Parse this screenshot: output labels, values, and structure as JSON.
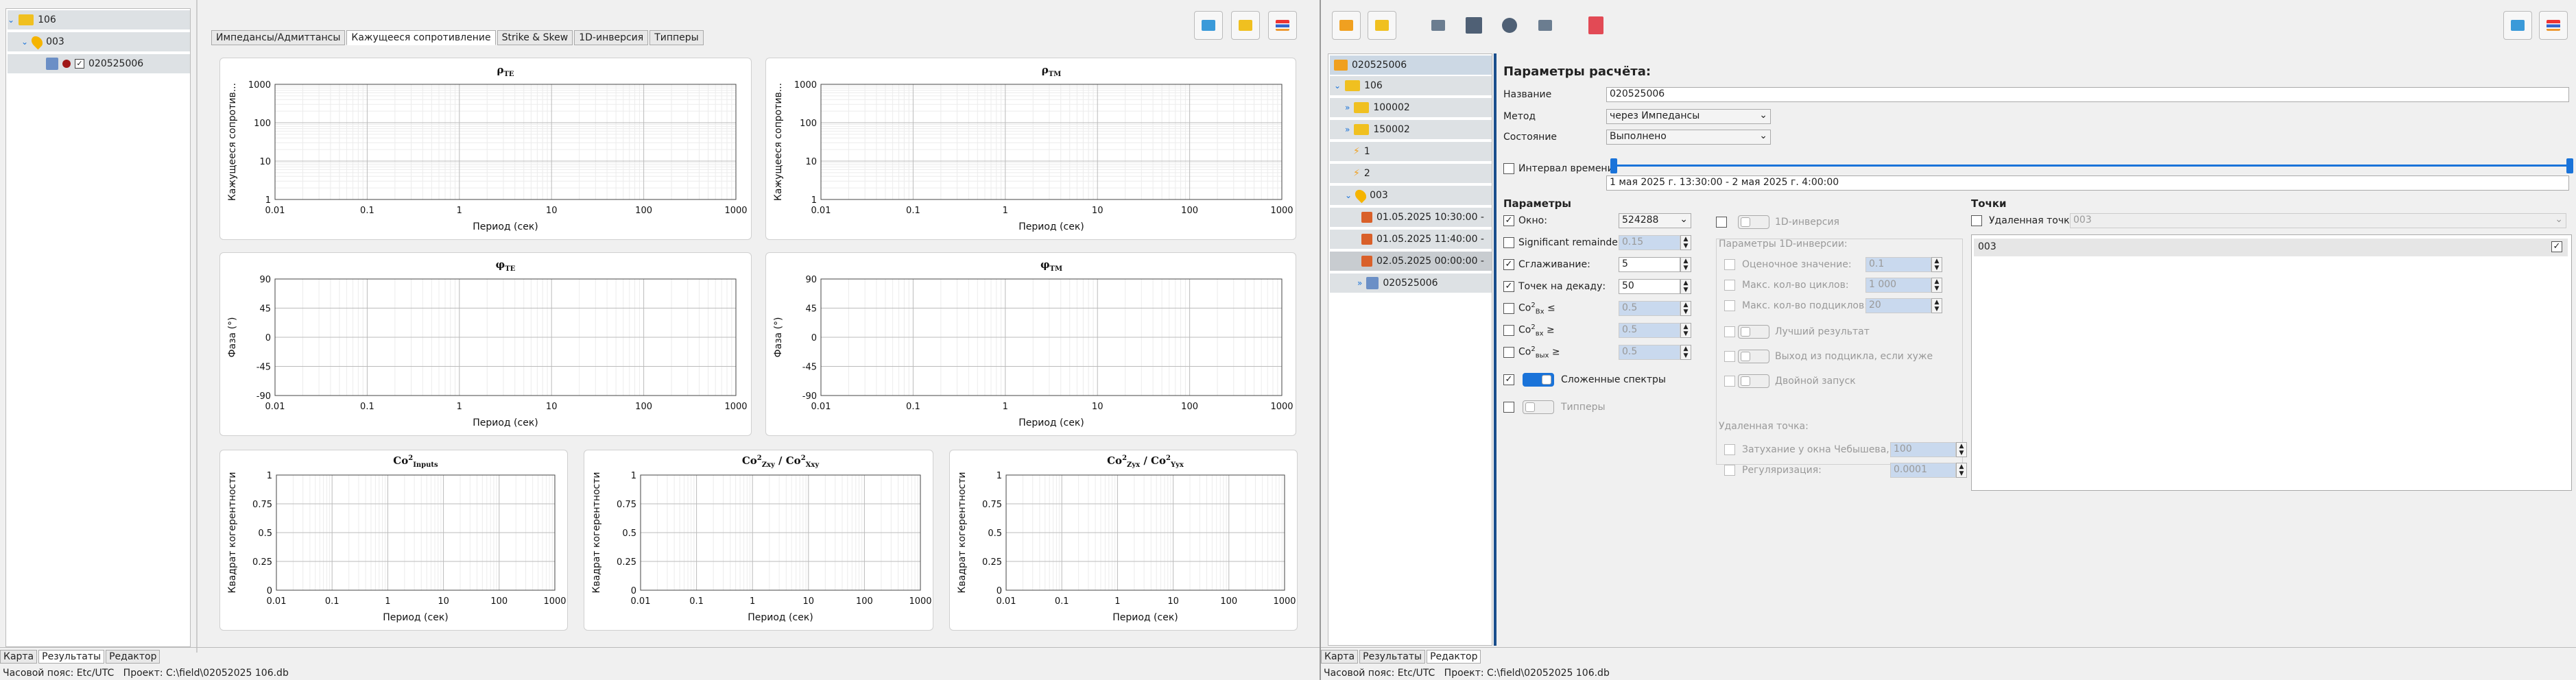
{
  "left_tree": {
    "items": [
      {
        "label": "106"
      },
      {
        "label": "003"
      },
      {
        "label": "020525006"
      }
    ]
  },
  "plot_tabs": [
    "Импедансы/Адмиттансы",
    "Кажущееся сопротивление",
    "Strike & Skew",
    "1D-инверсия",
    "Типперы"
  ],
  "active_tab": 1,
  "bottom_tabs": [
    "Карта",
    "Результаты",
    "Редактор"
  ],
  "status": {
    "tz": "Часовой пояс: Etc/UTC",
    "project": "Проект: C:\\field\\02052025 106.db"
  },
  "charts": {
    "rho_te": {
      "title": "ρ",
      "sub": "TE",
      "ylabel": "Кажущееся сопротив...",
      "xlabel": "Период (сек)",
      "xticks": [
        "0.01",
        "0.1",
        "1",
        "10",
        "100",
        "1000"
      ],
      "yticks": [
        "1000",
        "100",
        "10",
        "1"
      ]
    },
    "rho_tm": {
      "title": "ρ",
      "sub": "TM",
      "ylabel": "Кажущееся сопротив...",
      "xlabel": "Период (сек)",
      "xticks": [
        "0.01",
        "0.1",
        "1",
        "10",
        "100",
        "1000"
      ],
      "yticks": [
        "1000",
        "100",
        "10",
        "1"
      ]
    },
    "phi_te": {
      "title": "φ",
      "sub": "TE",
      "ylabel": "Фаза (°)",
      "xlabel": "Период (сек)",
      "xticks": [
        "0.01",
        "0.1",
        "1",
        "10",
        "100",
        "1000"
      ],
      "yticks": [
        "90",
        "45",
        "0",
        "-45",
        "-90"
      ]
    },
    "phi_tm": {
      "title": "φ",
      "sub": "TM",
      "ylabel": "Фаза (°)",
      "xlabel": "Период (сек)",
      "xticks": [
        "0.01",
        "0.1",
        "1",
        "10",
        "100",
        "1000"
      ],
      "yticks": [
        "90",
        "45",
        "0",
        "-45",
        "-90"
      ]
    },
    "coh_in": {
      "title": "Co",
      "sup": "2",
      "sub": "Inputs",
      "ylabel": "Квадрат когерентности",
      "xlabel": "Период (сек)",
      "xticks": [
        "0.01",
        "0.1",
        "1",
        "10",
        "100",
        "1000"
      ],
      "yticks": [
        "1",
        "0.75",
        "0.5",
        "0.25",
        "0"
      ]
    },
    "coh_zxy": {
      "title": "Co",
      "sup": "2",
      "sub": "Zxy",
      "title2": " / Co",
      "sup2": "2",
      "sub2": "Xxy",
      "ylabel": "Квадрат когерентности",
      "xlabel": "Период (сек)",
      "xticks": [
        "0.01",
        "0.1",
        "1",
        "10",
        "100",
        "1000"
      ],
      "yticks": [
        "1",
        "0.75",
        "0.5",
        "0.25",
        "0"
      ]
    },
    "coh_zyx": {
      "title": "Co",
      "sup": "2",
      "sub": "Zyx",
      "title2": " / Co",
      "sup2": "2",
      "sub2": "Yyx",
      "ylabel": "Квадрат когерентности",
      "xlabel": "Период (сек)",
      "xticks": [
        "0.01",
        "0.1",
        "1",
        "10",
        "100",
        "1000"
      ],
      "yticks": [
        "1",
        "0.75",
        "0.5",
        "0.25",
        "0"
      ]
    }
  },
  "right_tree": {
    "items": [
      {
        "label": "020525006"
      },
      {
        "label": "106"
      },
      {
        "label": "100002"
      },
      {
        "label": "150002"
      },
      {
        "label": "1"
      },
      {
        "label": "2"
      },
      {
        "label": "003"
      },
      {
        "label": "01.05.2025 10:30:00 -"
      },
      {
        "label": "01.05.2025 11:40:00 -"
      },
      {
        "label": "02.05.2025 00:00:00 -"
      },
      {
        "label": "020525006"
      }
    ]
  },
  "form": {
    "heading": "Параметры расчёта:",
    "name_label": "Название",
    "name_value": "020525006",
    "method_label": "Метод",
    "method_value": "через Импедансы",
    "state_label": "Состояние",
    "state_value": "Выполнено",
    "interval_label": "Интервал времени",
    "interval_value": "1 мая 2025 г. 13:30:00 - 2 мая 2025 г. 4:00:00",
    "params_heading": "Параметры",
    "window_label": "Окно:",
    "window_value": "524288",
    "sig_label": "Significant remainder:",
    "sig_value": "0.15",
    "smooth_label": "Сглаживание:",
    "smooth_value": "5",
    "ppd_label": "Точек на декаду:",
    "ppd_value": "50",
    "co_bx_label": "Co",
    "co_bx_sub": "Bx",
    "co_bx_sfx": " ≤",
    "co_bx_value": "0.5",
    "co_in_label": "Co",
    "co_in_sub": "вх",
    "co_in_sfx": " ≥",
    "co_in_value": "0.5",
    "co_out_label": "Co",
    "co_out_sub": "вых",
    "co_out_sfx": " ≥",
    "co_out_value": "0.5",
    "stacked_label": "Сложенные спектры",
    "tippers_label": "Типперы",
    "inv1d_label": "1D-инверсия",
    "inv_params_heading": "Параметры 1D-инверсии:",
    "est_label": "Оценочное значение:",
    "est_value": "0.1",
    "maxcyc_label": "Макс. кол-во циклов:",
    "maxcyc_value": "1 000",
    "maxsub_label": "Макс. кол-во подциклов:",
    "maxsub_value": "20",
    "best_label": "Лучший результат",
    "exit_label": "Выход из подцикла, если хуже",
    "double_label": "Двойной запуск",
    "remote_heading": "Удаленная точка:",
    "cheb_label": "Затухание у окна Чебышева, дБ:",
    "cheb_value": "100",
    "reg_label": "Регуляризация:",
    "reg_value": "0.0001",
    "points_heading": "Точки",
    "remote_pt_label": "Удаленная точка:",
    "remote_pt_value": "003",
    "point_item": "003"
  }
}
